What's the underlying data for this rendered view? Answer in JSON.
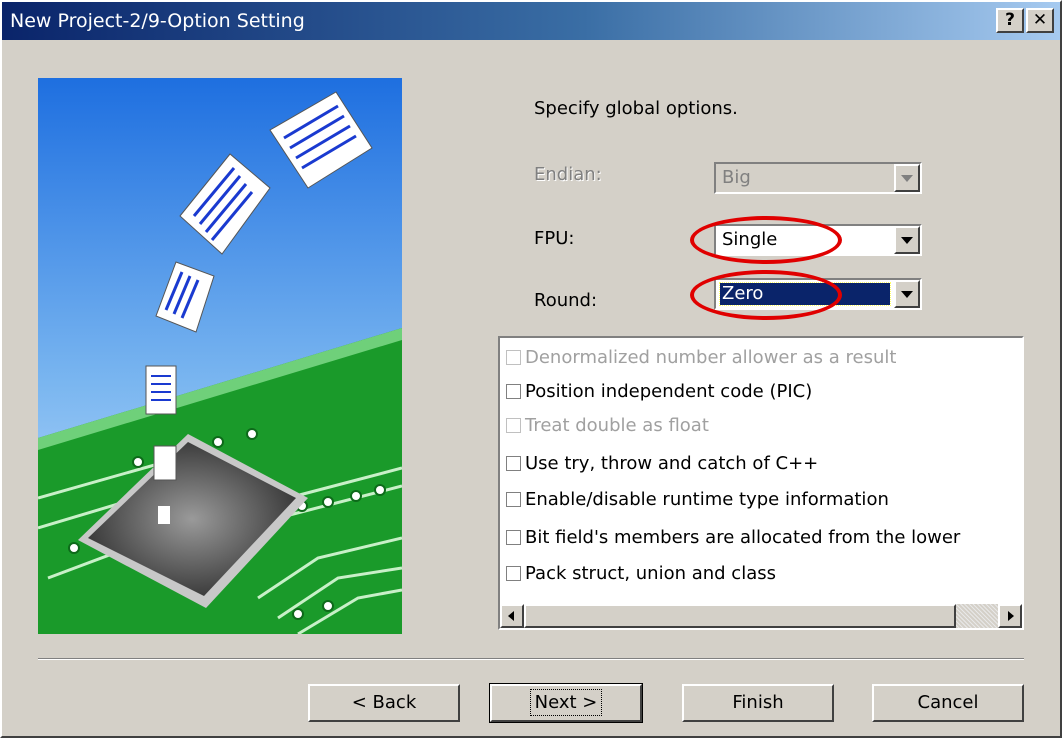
{
  "window": {
    "title": "New Project-2/9-Option Setting",
    "help_glyph": "?",
    "close_glyph": "✕"
  },
  "main": {
    "prompt": "Specify global options.",
    "endian": {
      "label": "Endian:",
      "value": "Big",
      "enabled": false
    },
    "fpu": {
      "label": "FPU:",
      "value": "Single",
      "enabled": true
    },
    "round": {
      "label": "Round:",
      "value": "Zero",
      "enabled": true,
      "focused": true
    }
  },
  "options": {
    "items": [
      {
        "label": "Denormalized number allower as a result",
        "checked": false,
        "enabled": false
      },
      {
        "label": "Position independent code (PIC)",
        "checked": false,
        "enabled": true
      },
      {
        "label": "Treat double as float",
        "checked": false,
        "enabled": false
      },
      {
        "label": "Use try, throw and catch of C++",
        "checked": false,
        "enabled": true
      },
      {
        "label": "Enable/disable runtime type information",
        "checked": false,
        "enabled": true
      },
      {
        "label": "Bit field's members are allocated from the lower",
        "checked": false,
        "enabled": true
      },
      {
        "label": "Pack struct, union and class",
        "checked": false,
        "enabled": true
      }
    ]
  },
  "buttons": {
    "back": "< Back",
    "next": "Next >",
    "finish": "Finish",
    "cancel": "Cancel"
  },
  "colors": {
    "titlebar_start": "#0a246a",
    "titlebar_end": "#a6caf0",
    "dialog_face": "#d4d0c8",
    "annotation": "#e00000",
    "selection": "#0a246a"
  }
}
